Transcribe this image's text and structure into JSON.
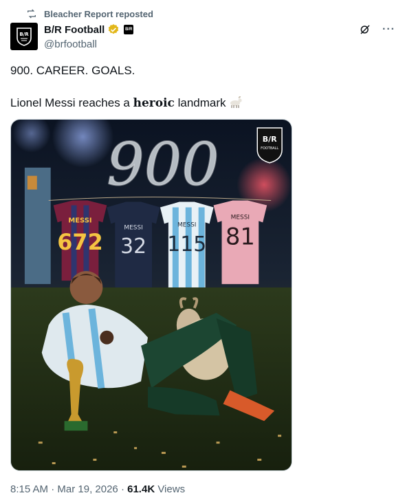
{
  "repost": {
    "label": "Bleacher Report reposted",
    "icon": "repost-icon"
  },
  "author": {
    "name": "B/R Football",
    "handle": "@brfootball",
    "avatar_text": "B/R",
    "verified_color": "#e2b719",
    "affiliate_badge_text": "B/R"
  },
  "actions": {
    "grok_icon": "grok-icon",
    "more_label": "···"
  },
  "tweet": {
    "line1": "900. CAREER. GOALS.",
    "line2_prefix": "Lionel Messi reaches a ",
    "line2_bold": "heroic",
    "line2_suffix": " landmark ",
    "emoji": "goat-emoji"
  },
  "media": {
    "smoke_text": "900",
    "logo_top": "B/R",
    "logo_bottom": "FOOTBALL",
    "shirts": [
      {
        "name": "MESSI",
        "number": "672",
        "color": "#7a1f3d"
      },
      {
        "name": "MESSI",
        "number": "32",
        "color": "#1f2a44"
      },
      {
        "name": "MESSI",
        "number": "115",
        "color": "#cfe6f2"
      },
      {
        "name": "MESSI",
        "number": "81",
        "color": "#e9a9b6"
      }
    ]
  },
  "meta": {
    "time": "8:15 AM",
    "date": "Mar 19, 2026",
    "views_count": "61.4K",
    "views_label": "Views",
    "sep": " · "
  },
  "colors": {
    "text": "#0f1419",
    "secondary": "#536471",
    "border": "#cfd9de"
  }
}
